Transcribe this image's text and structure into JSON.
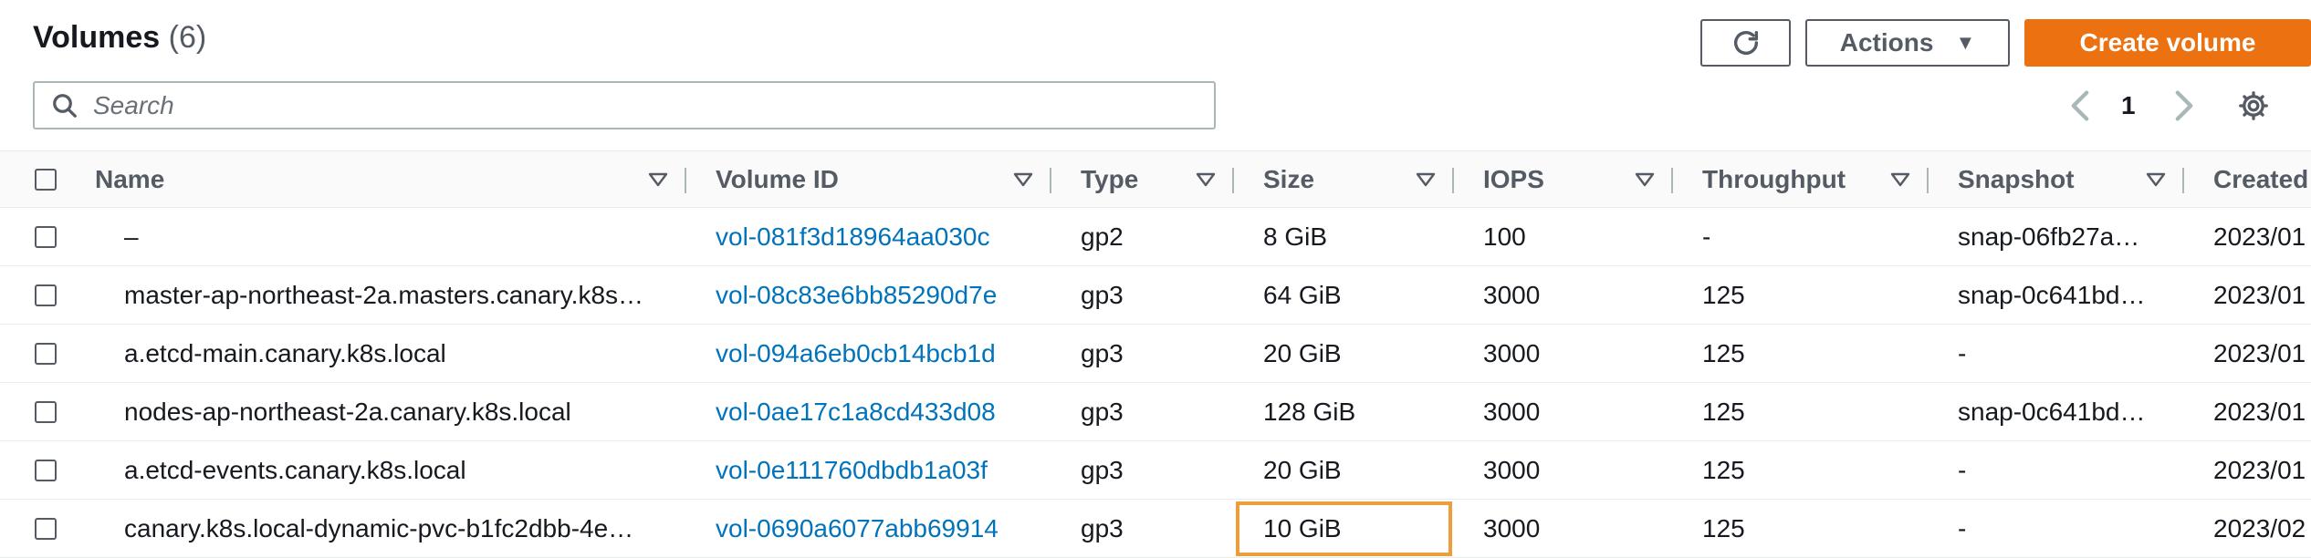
{
  "header": {
    "title": "Volumes",
    "count": "(6)",
    "actions_label": "Actions",
    "create_label": "Create volume"
  },
  "search": {
    "placeholder": "Search",
    "value": ""
  },
  "pagination": {
    "current_page": "1"
  },
  "table": {
    "columns": [
      "Name",
      "Volume ID",
      "Type",
      "Size",
      "IOPS",
      "Throughput",
      "Snapshot",
      "Created"
    ],
    "rows": [
      {
        "name": "–",
        "volume_id": "vol-081f3d18964aa030c",
        "type": "gp2",
        "size": "8 GiB",
        "iops": "100",
        "throughput": "-",
        "snapshot": "snap-06fb27a…",
        "created": "2023/01"
      },
      {
        "name": "master-ap-northeast-2a.masters.canary.k8s…",
        "volume_id": "vol-08c83e6bb85290d7e",
        "type": "gp3",
        "size": "64 GiB",
        "iops": "3000",
        "throughput": "125",
        "snapshot": "snap-0c641bd…",
        "created": "2023/01"
      },
      {
        "name": "a.etcd-main.canary.k8s.local",
        "volume_id": "vol-094a6eb0cb14bcb1d",
        "type": "gp3",
        "size": "20 GiB",
        "iops": "3000",
        "throughput": "125",
        "snapshot": "-",
        "created": "2023/01"
      },
      {
        "name": "nodes-ap-northeast-2a.canary.k8s.local",
        "volume_id": "vol-0ae17c1a8cd433d08",
        "type": "gp3",
        "size": "128 GiB",
        "iops": "3000",
        "throughput": "125",
        "snapshot": "snap-0c641bd…",
        "created": "2023/01"
      },
      {
        "name": "a.etcd-events.canary.k8s.local",
        "volume_id": "vol-0e111760dbdb1a03f",
        "type": "gp3",
        "size": "20 GiB",
        "iops": "3000",
        "throughput": "125",
        "snapshot": "-",
        "created": "2023/01"
      },
      {
        "name": "canary.k8s.local-dynamic-pvc-b1fc2dbb-4e…",
        "volume_id": "vol-0690a6077abb69914",
        "type": "gp3",
        "size": "10 GiB",
        "iops": "3000",
        "throughput": "125",
        "snapshot": "-",
        "created": "2023/02"
      }
    ]
  },
  "colors": {
    "accent": "#ec7211",
    "link": "#0073bb",
    "highlight": "#ec9d3c"
  },
  "icons": [
    "refresh-icon",
    "caret-down-icon",
    "search-icon",
    "chevron-left-icon",
    "chevron-right-icon",
    "gear-icon",
    "sort-triangle-icon"
  ]
}
